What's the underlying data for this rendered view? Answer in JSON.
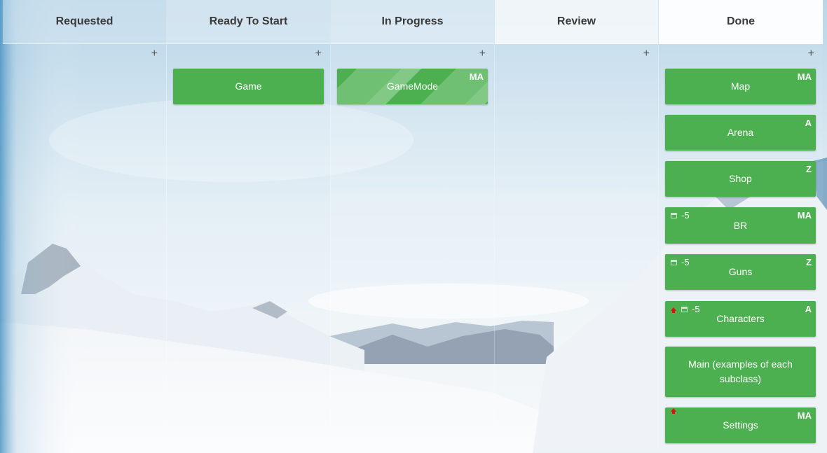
{
  "columns": [
    {
      "title": "Requested",
      "add": "+",
      "cards": []
    },
    {
      "title": "Ready To Start",
      "add": "+",
      "cards": [
        {
          "title": "Game",
          "assignee": "",
          "due": "",
          "priority": false,
          "striped": false
        }
      ]
    },
    {
      "title": "In Progress",
      "add": "+",
      "cards": [
        {
          "title": "GameMode",
          "assignee": "MA",
          "due": "",
          "priority": false,
          "striped": true
        }
      ]
    },
    {
      "title": "Review",
      "add": "+",
      "cards": []
    },
    {
      "title": "Done",
      "add": "+",
      "cards": [
        {
          "title": "Map",
          "assignee": "MA",
          "due": "",
          "priority": false,
          "striped": false
        },
        {
          "title": "Arena",
          "assignee": "A",
          "due": "",
          "priority": false,
          "striped": false
        },
        {
          "title": "Shop",
          "assignee": "Z",
          "due": "",
          "priority": false,
          "striped": false
        },
        {
          "title": "BR",
          "assignee": "MA",
          "due": "-5",
          "priority": false,
          "striped": false
        },
        {
          "title": "Guns",
          "assignee": "Z",
          "due": "-5",
          "priority": false,
          "striped": false
        },
        {
          "title": "Characters",
          "assignee": "A",
          "due": "-5",
          "priority": true,
          "striped": false
        },
        {
          "title": "Main (examples of each subclass)",
          "assignee": "",
          "due": "",
          "priority": false,
          "striped": false
        },
        {
          "title": "Settings",
          "assignee": "MA",
          "due": "",
          "priority": true,
          "striped": false
        }
      ]
    }
  ],
  "colors": {
    "card": "#4caf50",
    "card_stripe": "#82c985",
    "priority": "#e01010",
    "header_text": "#3a3a3a"
  },
  "icons": {
    "add": "plus-icon",
    "due": "calendar-icon",
    "priority": "priority-up-arrow-icon"
  }
}
